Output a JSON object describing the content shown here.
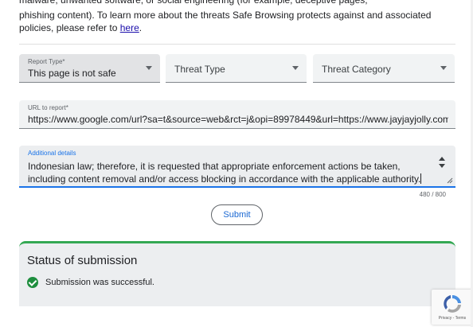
{
  "intro": {
    "top_clipped": "malware, unwanted software, or social engineering (for example, deceptive pages,",
    "text": "phishing content). To learn more about the threats Safe Browsing protects against and associated policies, please refer to ",
    "link": "here",
    "end": "."
  },
  "form": {
    "report_type": {
      "label": "Report Type*",
      "value": "This page is not safe"
    },
    "threat_type": {
      "placeholder": "Threat Type"
    },
    "threat_category": {
      "placeholder": "Threat Category"
    },
    "url": {
      "label": "URL to report*",
      "value": "https://www.google.com/url?sa=t&source=web&rct=j&opi=89978449&url=https://www.jayjayjolly.com/program"
    },
    "details": {
      "label": "Additional details",
      "value": "Indonesian law; therefore, it is requested that appropriate enforcement actions be taken, including content removal and/or access blocking in accordance with the applicable authority."
    },
    "counter": "480 / 800",
    "submit_label": "Submit"
  },
  "status": {
    "title": "Status of submission",
    "message": "Submission was successful."
  },
  "recaptcha": {
    "privacy": "Privacy",
    "sep": " - ",
    "terms": "Terms"
  },
  "colors": {
    "accent": "#1a73e8",
    "success": "#1e8e3e",
    "link": "#1a0dab"
  }
}
